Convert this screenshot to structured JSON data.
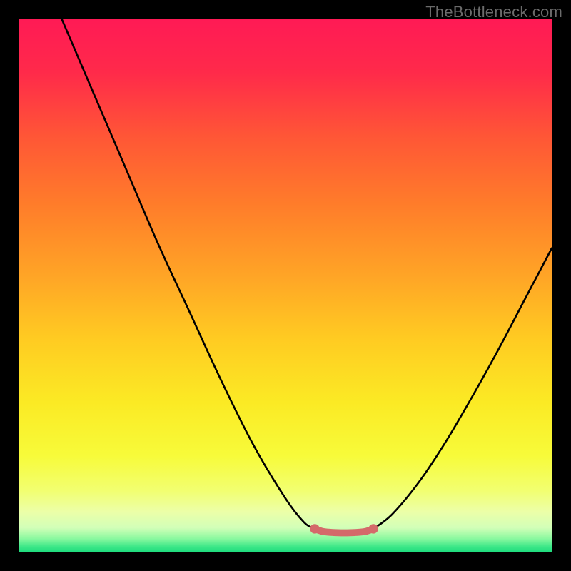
{
  "watermark": "TheBottleneck.com",
  "chart_data": {
    "type": "line",
    "title": "",
    "xlabel": "",
    "ylabel": "",
    "xlim": [
      0,
      100
    ],
    "ylim": [
      0,
      100
    ],
    "left_curve": {
      "name": "left-branch",
      "points": [
        {
          "x": 8.0,
          "y": 100.0
        },
        {
          "x": 14.0,
          "y": 86.0
        },
        {
          "x": 20.0,
          "y": 72.0
        },
        {
          "x": 26.0,
          "y": 58.0
        },
        {
          "x": 32.0,
          "y": 45.0
        },
        {
          "x": 38.0,
          "y": 32.0
        },
        {
          "x": 44.0,
          "y": 20.0
        },
        {
          "x": 50.0,
          "y": 10.0
        },
        {
          "x": 53.5,
          "y": 5.5
        },
        {
          "x": 55.5,
          "y": 4.3
        }
      ]
    },
    "valley_curve": {
      "name": "valley-floor",
      "color": "#d46a6a",
      "points": [
        {
          "x": 55.5,
          "y": 4.3
        },
        {
          "x": 57.0,
          "y": 3.8
        },
        {
          "x": 59.0,
          "y": 3.6
        },
        {
          "x": 61.0,
          "y": 3.55
        },
        {
          "x": 63.0,
          "y": 3.6
        },
        {
          "x": 65.0,
          "y": 3.8
        },
        {
          "x": 66.5,
          "y": 4.3
        }
      ]
    },
    "right_curve": {
      "name": "right-branch",
      "points": [
        {
          "x": 66.5,
          "y": 4.3
        },
        {
          "x": 70.0,
          "y": 7.0
        },
        {
          "x": 75.0,
          "y": 13.0
        },
        {
          "x": 80.0,
          "y": 20.5
        },
        {
          "x": 85.0,
          "y": 29.0
        },
        {
          "x": 90.0,
          "y": 38.0
        },
        {
          "x": 95.0,
          "y": 47.5
        },
        {
          "x": 100.0,
          "y": 57.0
        }
      ]
    },
    "gradient_stops": [
      {
        "offset": 0.0,
        "color": "#ff1a55"
      },
      {
        "offset": 0.1,
        "color": "#ff2a4a"
      },
      {
        "offset": 0.22,
        "color": "#ff5636"
      },
      {
        "offset": 0.35,
        "color": "#ff7d2a"
      },
      {
        "offset": 0.48,
        "color": "#ffa426"
      },
      {
        "offset": 0.6,
        "color": "#ffcb22"
      },
      {
        "offset": 0.72,
        "color": "#fbea24"
      },
      {
        "offset": 0.82,
        "color": "#f7fb3a"
      },
      {
        "offset": 0.885,
        "color": "#f2ff70"
      },
      {
        "offset": 0.925,
        "color": "#ecffa8"
      },
      {
        "offset": 0.955,
        "color": "#d2ffb8"
      },
      {
        "offset": 0.975,
        "color": "#8cf9a0"
      },
      {
        "offset": 0.99,
        "color": "#3fe889"
      },
      {
        "offset": 1.0,
        "color": "#1fdc7e"
      }
    ]
  }
}
